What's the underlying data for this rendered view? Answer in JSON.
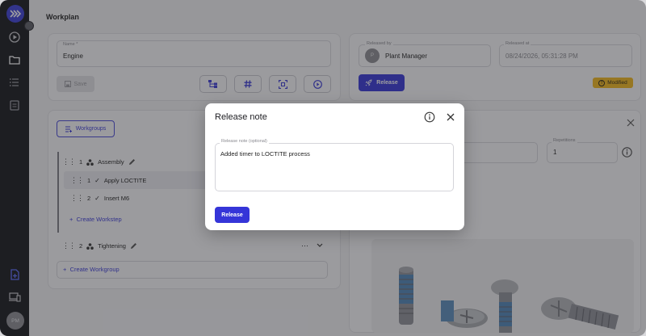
{
  "page": {
    "title": "Workplan"
  },
  "sidebar": {
    "avatar_initials": "PM"
  },
  "left_panel": {
    "name_label": "Name *",
    "name_value": "Engine",
    "save_label": "Save",
    "workgroups_label": "Workgroups",
    "groups": [
      {
        "number": "1",
        "name": "Assembly",
        "steps": [
          {
            "number": "1",
            "name": "Apply LOCTITE"
          },
          {
            "number": "2",
            "name": "Insert M6"
          }
        ],
        "create_step_label": "Create Workstep"
      },
      {
        "number": "2",
        "name": "Tightening"
      }
    ],
    "create_group_label": "Create Workgroup"
  },
  "right_panel": {
    "released_by_label": "Released by",
    "released_by_value": "Plant Manager",
    "released_by_initial": "P",
    "released_at_label": "Released at",
    "released_at_value": "08/24/2026, 05:31:28 PM",
    "release_label": "Release",
    "status_badge": "Modified",
    "repetitions_label": "Repetitions",
    "repetitions_value": "1"
  },
  "modal": {
    "title": "Release note",
    "note_label": "Release note (optional)",
    "note_value": "Added timer to LOCTITE process",
    "release_button": "Release"
  },
  "colors": {
    "accent": "#3535d8",
    "badge": "#f2b81c",
    "sidebar": "#15161b"
  },
  "icons": [
    "logo-icon",
    "play-circle-icon",
    "folder-icon",
    "list-icon",
    "clipboard-icon",
    "add-document-icon",
    "devices-icon",
    "info-icon",
    "close-icon",
    "rocket-icon",
    "save-icon"
  ]
}
